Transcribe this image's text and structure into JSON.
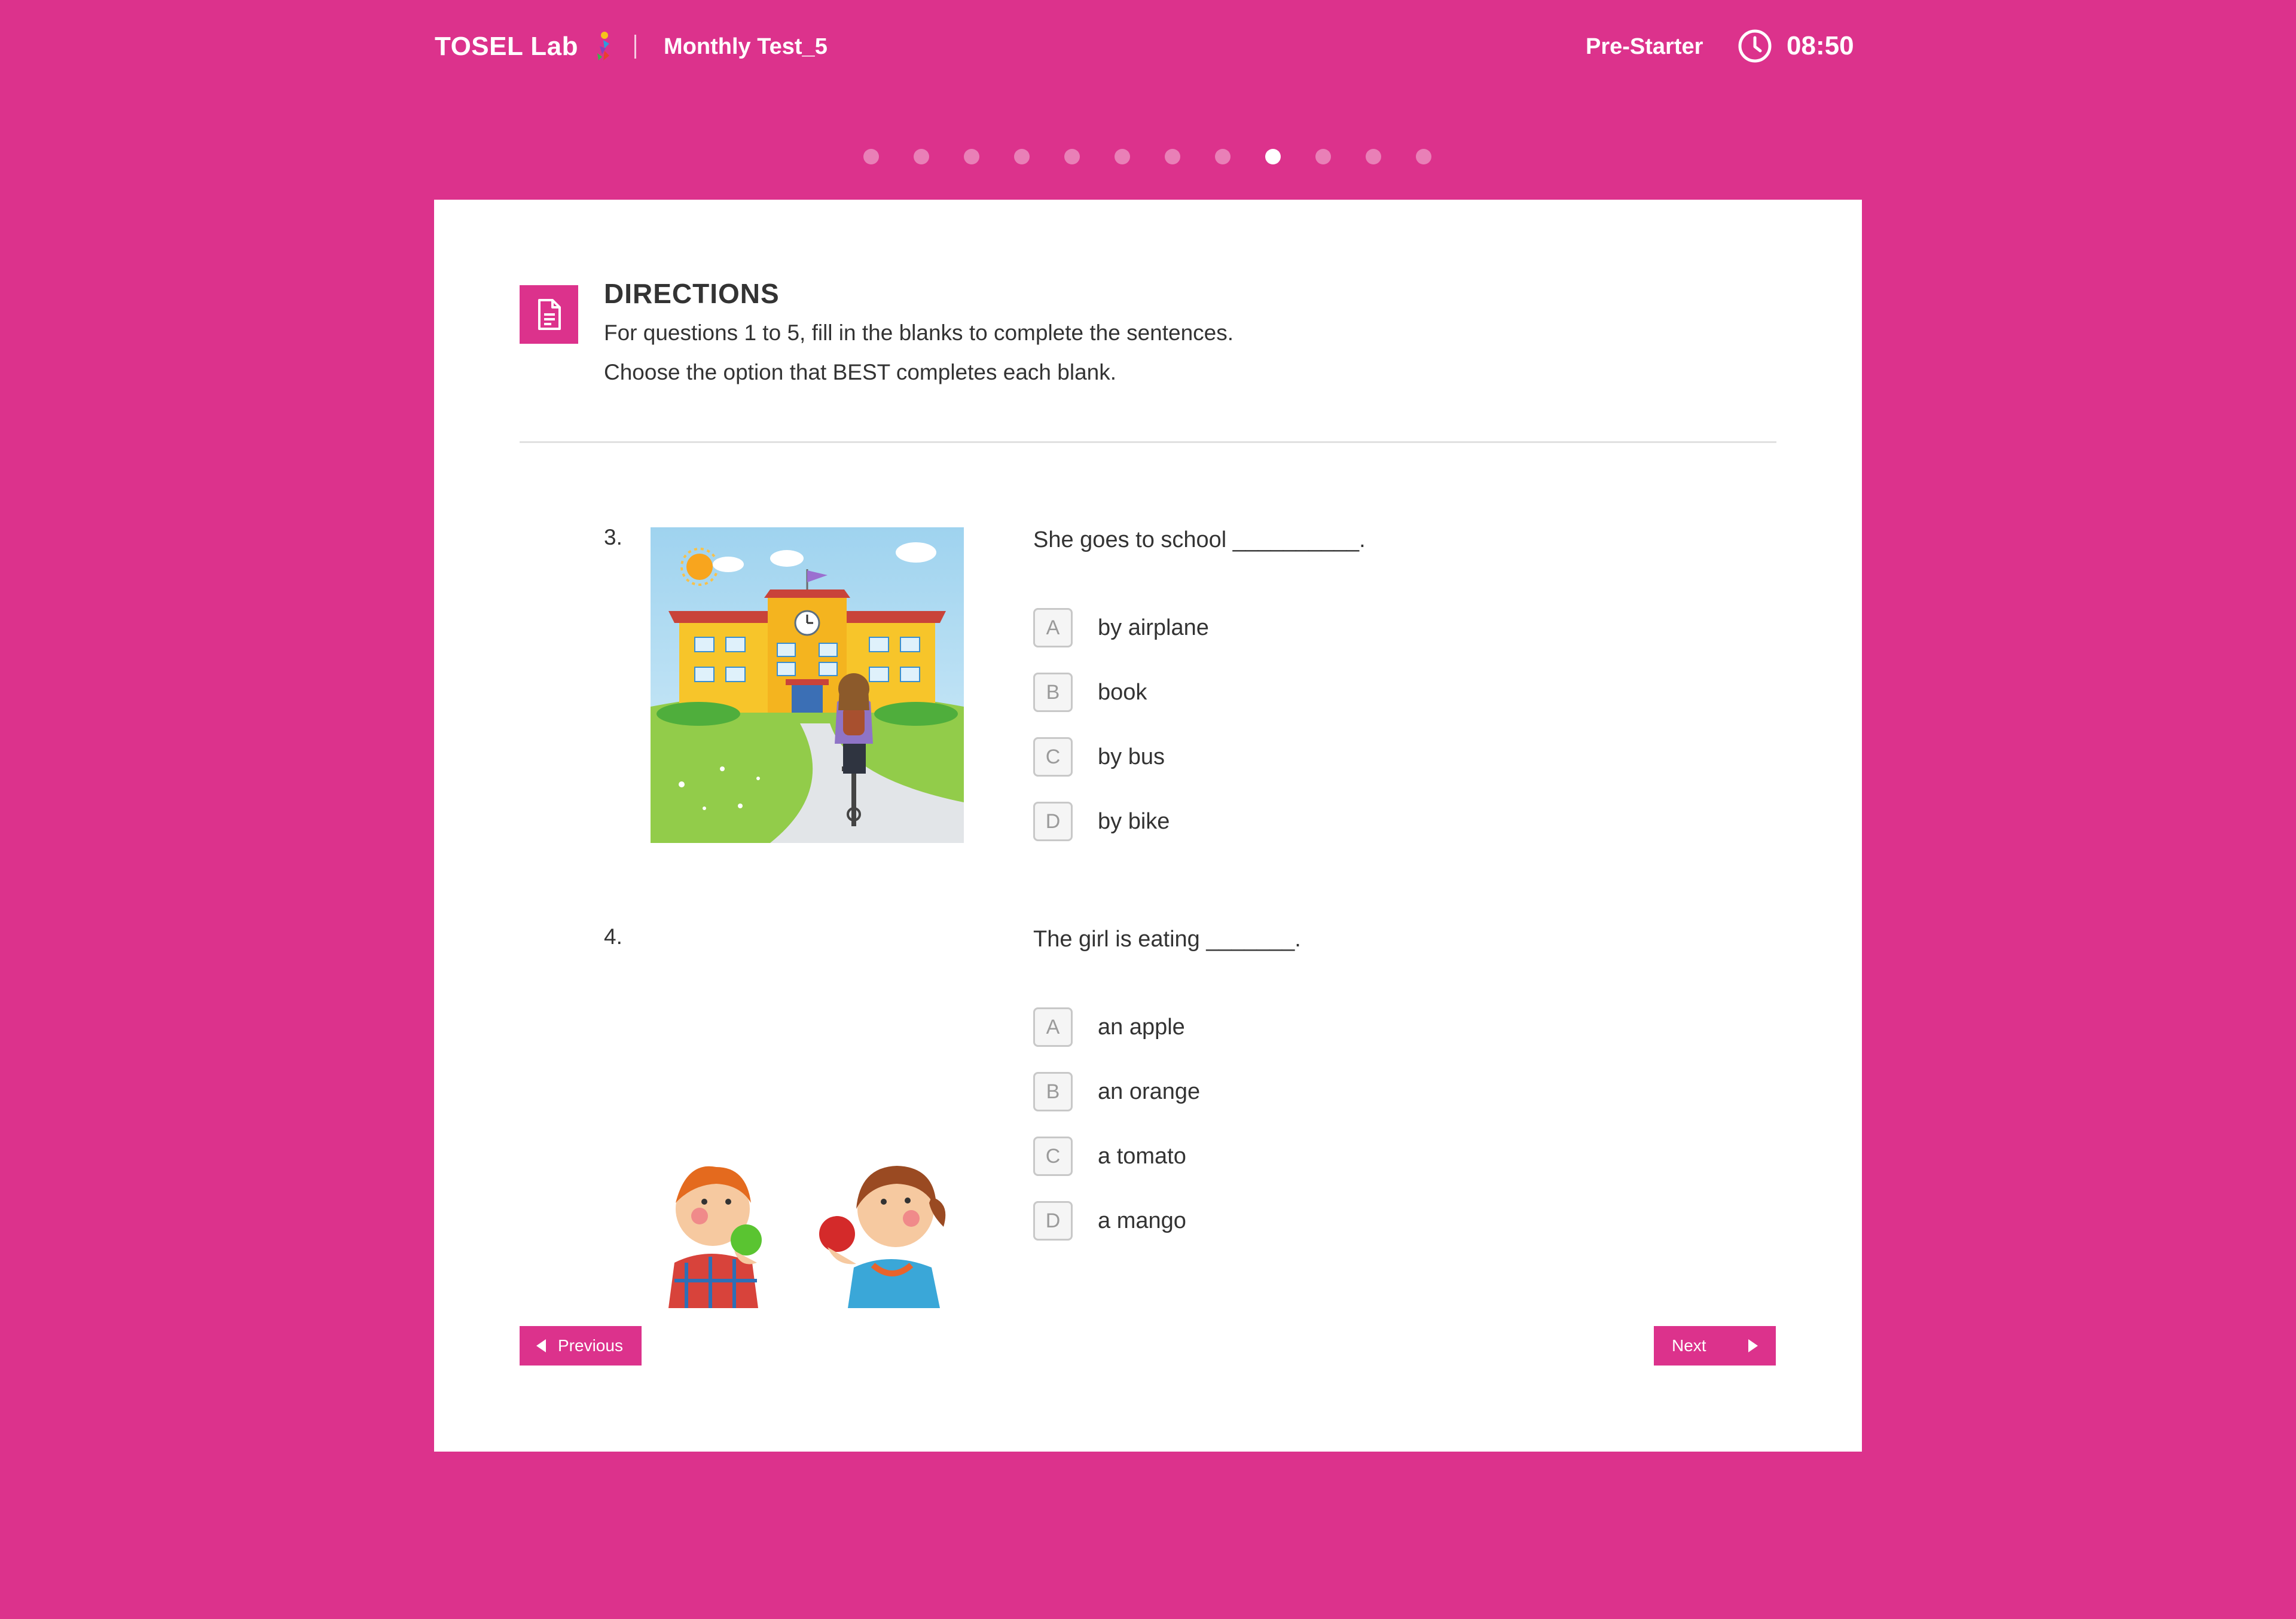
{
  "header": {
    "brand": "TOSEL Lab",
    "test_name": "Monthly Test_5",
    "level": "Pre-Starter",
    "timer": "08:50"
  },
  "progress": {
    "total": 12,
    "current": 9
  },
  "directions": {
    "title": "DIRECTIONS",
    "line1": "For questions 1 to 5, fill in the blanks to complete the sentences.",
    "line2": "Choose the option that BEST completes each blank."
  },
  "questions": [
    {
      "number": "3.",
      "text": "She goes to school __________.",
      "image_icon": "girl-biking-to-school-illustration",
      "options": [
        {
          "letter": "A",
          "label": "by airplane"
        },
        {
          "letter": "B",
          "label": "book"
        },
        {
          "letter": "C",
          "label": "by bus"
        },
        {
          "letter": "D",
          "label": "by bike"
        }
      ]
    },
    {
      "number": "4.",
      "text": "The girl is eating _______.",
      "image_icon": "kids-eating-apples-illustration",
      "options": [
        {
          "letter": "A",
          "label": "an apple"
        },
        {
          "letter": "B",
          "label": "an orange"
        },
        {
          "letter": "C",
          "label": "a tomato"
        },
        {
          "letter": "D",
          "label": "a mango"
        }
      ]
    }
  ],
  "nav": {
    "previous": "Previous",
    "next": "Next"
  },
  "colors": {
    "brand_pink": "#dc328c",
    "card": "#ffffff"
  }
}
